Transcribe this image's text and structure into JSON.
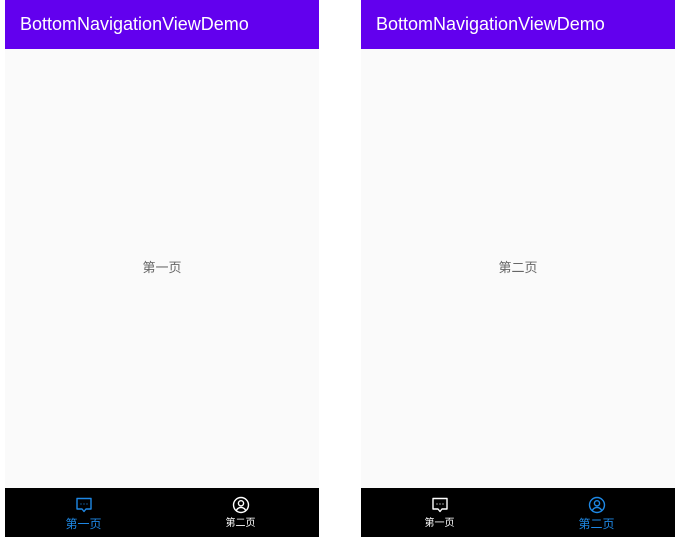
{
  "colors": {
    "app_bar": "#6200ee",
    "content_bg": "#fafafa",
    "bottom_nav_bg": "#000000",
    "nav_active": "#1e88e5",
    "nav_inactive": "#ffffff"
  },
  "screens": [
    {
      "app_bar_title": "BottomNavigationViewDemo",
      "page_text": "第一页",
      "nav_items": [
        {
          "label": "第一页",
          "icon": "message-icon",
          "active": true
        },
        {
          "label": "第二页",
          "icon": "account-icon",
          "active": false
        }
      ]
    },
    {
      "app_bar_title": "BottomNavigationViewDemo",
      "page_text": "第二页",
      "nav_items": [
        {
          "label": "第一页",
          "icon": "message-icon",
          "active": false
        },
        {
          "label": "第二页",
          "icon": "account-icon",
          "active": true
        }
      ]
    }
  ]
}
